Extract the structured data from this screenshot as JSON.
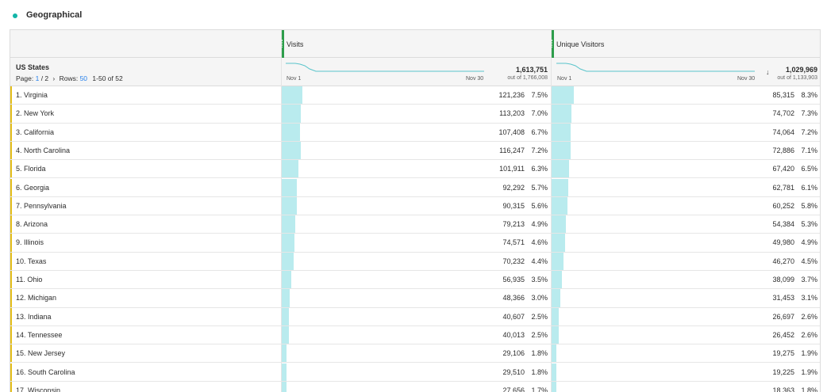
{
  "panel": {
    "title": "Geographical"
  },
  "metrics": [
    {
      "name": "Visits",
      "total": "1,613,751",
      "total_sub": "out of 1,766,008",
      "trend_start": "Nov 1",
      "trend_end": "Nov 30"
    },
    {
      "name": "Unique Visitors",
      "total": "1,029,969",
      "total_sub": "out of 1,133,903",
      "trend_start": "Nov 1",
      "trend_end": "Nov 30",
      "sort": "↓"
    }
  ],
  "dimension": {
    "title": "US States",
    "page_label": "Page:",
    "page_current": "1",
    "page_sep": "/ 2",
    "rows_label": "Rows:",
    "rows_value": "50",
    "range": "1-50 of 52"
  },
  "rows": [
    {
      "label": "1.  Virginia",
      "visits": "121,236",
      "visits_pct": "7.5%",
      "visits_frac": 0.075,
      "uv": "85,315",
      "uv_pct": "8.3%",
      "uv_frac": 0.083
    },
    {
      "label": "2.  New York",
      "visits": "113,203",
      "visits_pct": "7.0%",
      "visits_frac": 0.07,
      "uv": "74,702",
      "uv_pct": "7.3%",
      "uv_frac": 0.073
    },
    {
      "label": "3.  California",
      "visits": "107,408",
      "visits_pct": "6.7%",
      "visits_frac": 0.067,
      "uv": "74,064",
      "uv_pct": "7.2%",
      "uv_frac": 0.072
    },
    {
      "label": "4.  North Carolina",
      "visits": "116,247",
      "visits_pct": "7.2%",
      "visits_frac": 0.072,
      "uv": "72,886",
      "uv_pct": "7.1%",
      "uv_frac": 0.071
    },
    {
      "label": "5.  Florida",
      "visits": "101,911",
      "visits_pct": "6.3%",
      "visits_frac": 0.063,
      "uv": "67,420",
      "uv_pct": "6.5%",
      "uv_frac": 0.065
    },
    {
      "label": "6.  Georgia",
      "visits": "92,292",
      "visits_pct": "5.7%",
      "visits_frac": 0.057,
      "uv": "62,781",
      "uv_pct": "6.1%",
      "uv_frac": 0.061
    },
    {
      "label": "7.  Pennsylvania",
      "visits": "90,315",
      "visits_pct": "5.6%",
      "visits_frac": 0.056,
      "uv": "60,252",
      "uv_pct": "5.8%",
      "uv_frac": 0.058
    },
    {
      "label": "8.  Arizona",
      "visits": "79,213",
      "visits_pct": "4.9%",
      "visits_frac": 0.049,
      "uv": "54,384",
      "uv_pct": "5.3%",
      "uv_frac": 0.053
    },
    {
      "label": "9.  Illinois",
      "visits": "74,571",
      "visits_pct": "4.6%",
      "visits_frac": 0.046,
      "uv": "49,980",
      "uv_pct": "4.9%",
      "uv_frac": 0.049
    },
    {
      "label": "10.  Texas",
      "visits": "70,232",
      "visits_pct": "4.4%",
      "visits_frac": 0.044,
      "uv": "46,270",
      "uv_pct": "4.5%",
      "uv_frac": 0.045
    },
    {
      "label": "11.  Ohio",
      "visits": "56,935",
      "visits_pct": "3.5%",
      "visits_frac": 0.035,
      "uv": "38,099",
      "uv_pct": "3.7%",
      "uv_frac": 0.037
    },
    {
      "label": "12.  Michigan",
      "visits": "48,366",
      "visits_pct": "3.0%",
      "visits_frac": 0.03,
      "uv": "31,453",
      "uv_pct": "3.1%",
      "uv_frac": 0.031
    },
    {
      "label": "13.  Indiana",
      "visits": "40,607",
      "visits_pct": "2.5%",
      "visits_frac": 0.025,
      "uv": "26,697",
      "uv_pct": "2.6%",
      "uv_frac": 0.026
    },
    {
      "label": "14.  Tennessee",
      "visits": "40,013",
      "visits_pct": "2.5%",
      "visits_frac": 0.025,
      "uv": "26,452",
      "uv_pct": "2.6%",
      "uv_frac": 0.026
    },
    {
      "label": "15.  New Jersey",
      "visits": "29,106",
      "visits_pct": "1.8%",
      "visits_frac": 0.018,
      "uv": "19,275",
      "uv_pct": "1.9%",
      "uv_frac": 0.019
    },
    {
      "label": "16.  South Carolina",
      "visits": "29,510",
      "visits_pct": "1.8%",
      "visits_frac": 0.018,
      "uv": "19,225",
      "uv_pct": "1.9%",
      "uv_frac": 0.019
    },
    {
      "label": "17.  Wisconsin",
      "visits": "27,656",
      "visits_pct": "1.7%",
      "visits_frac": 0.017,
      "uv": "18,363",
      "uv_pct": "1.8%",
      "uv_frac": 0.018
    }
  ],
  "colors": {
    "accent_dot": "#12b5a8",
    "metric_grip": "#2d9d4b",
    "bar": "#b9ebee",
    "row_accent": "#e4be1a",
    "link": "#2680eb"
  }
}
